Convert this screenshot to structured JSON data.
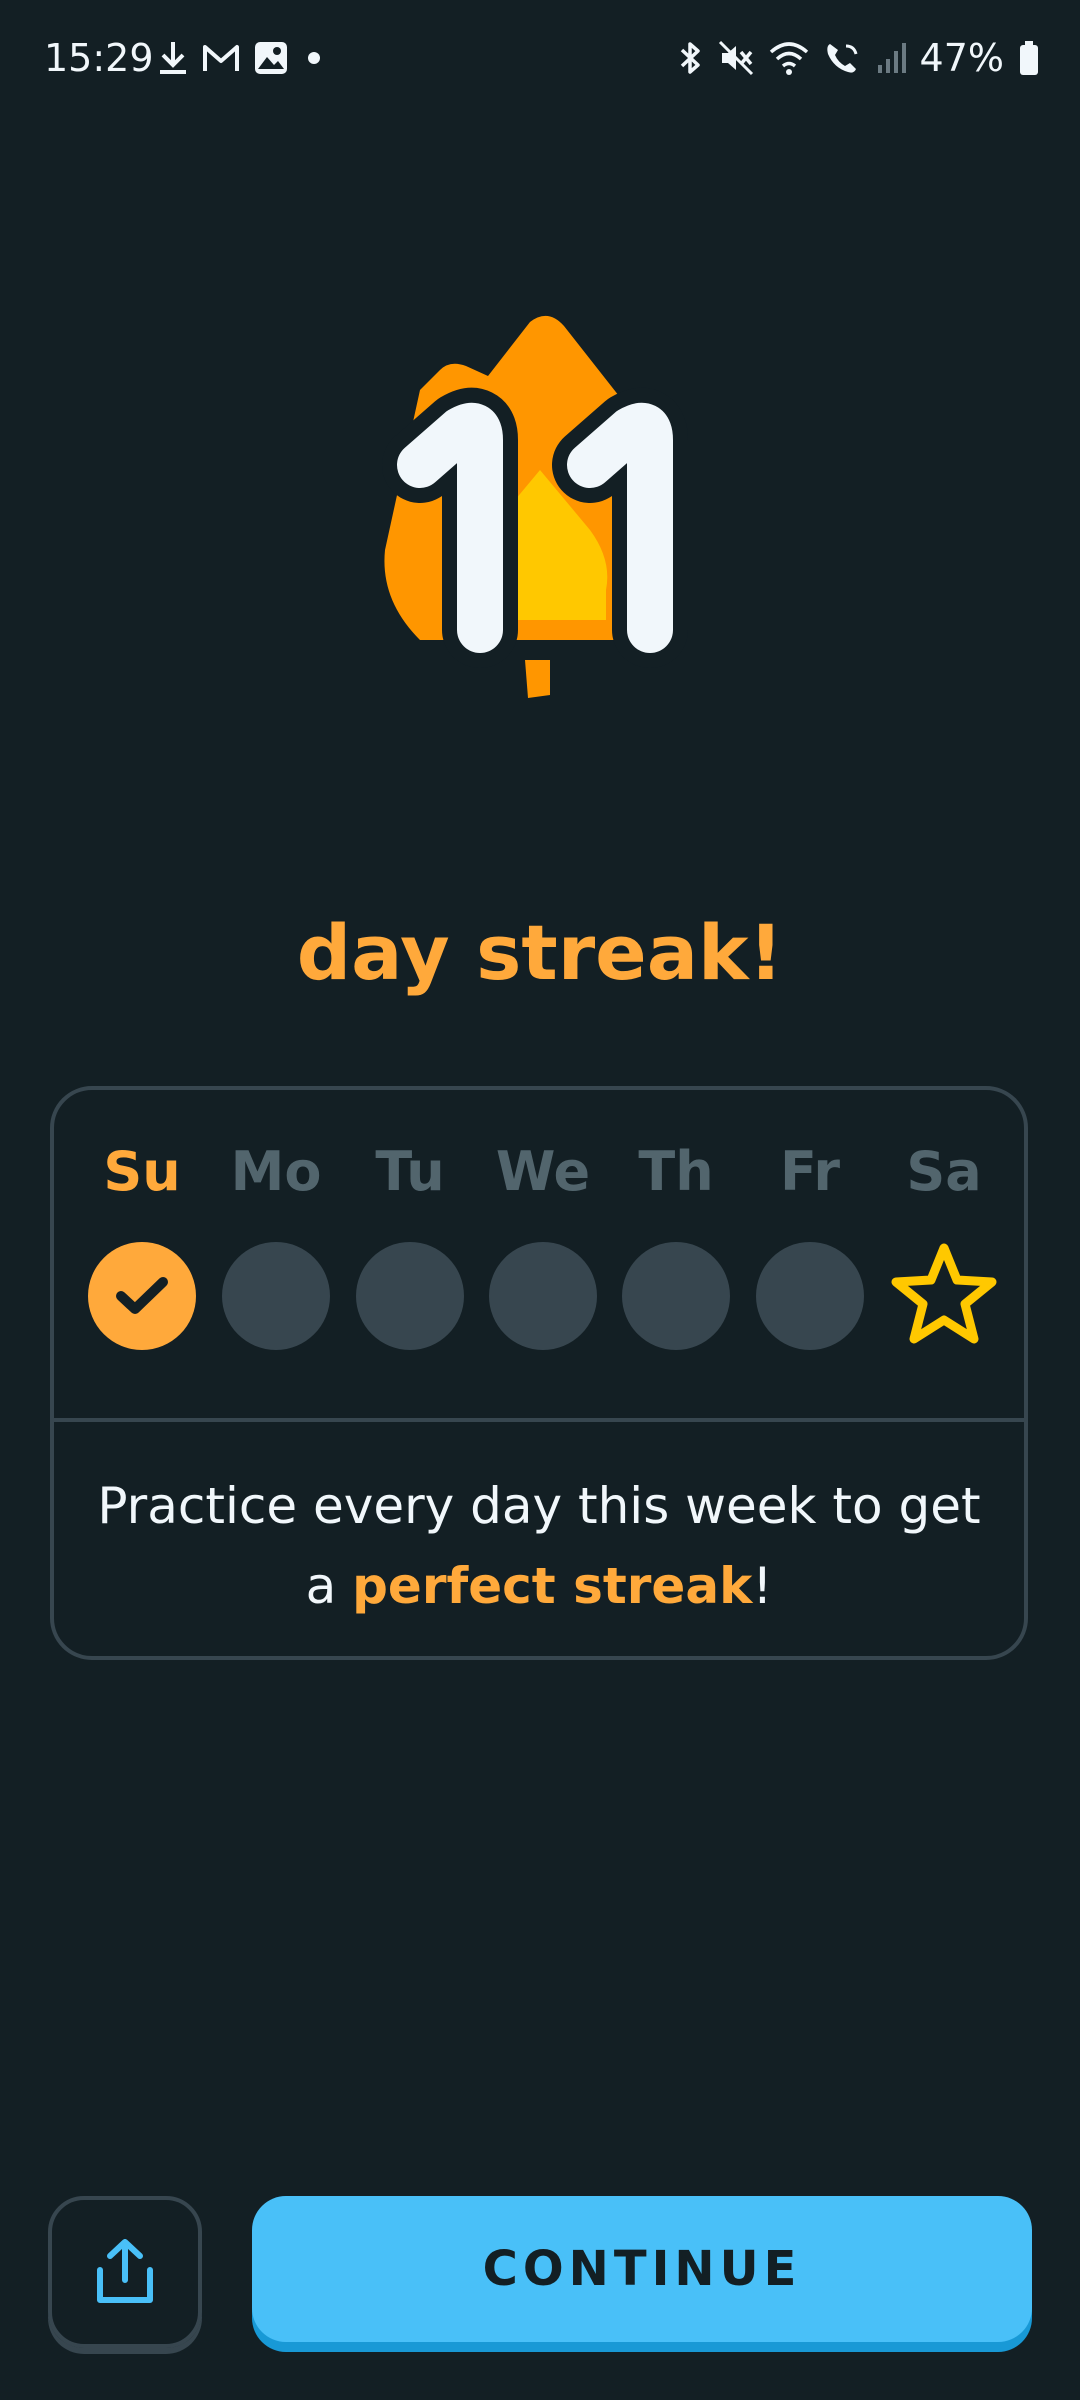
{
  "status_bar": {
    "time": "15:29",
    "battery": "47%",
    "left_icons": [
      "download-icon",
      "gmail-icon",
      "gallery-icon",
      "dot-icon"
    ],
    "right_icons": [
      "bluetooth-icon",
      "mute-icon",
      "wifi-icon",
      "wifi-calling-icon",
      "signal-icon",
      "battery-icon"
    ]
  },
  "streak": {
    "count": "11",
    "label": "day streak!",
    "flame_colors": {
      "outer": "#ff9600",
      "inner": "#ffc800"
    }
  },
  "week": {
    "days": [
      {
        "label": "Su",
        "state": "done"
      },
      {
        "label": "Mo",
        "state": "empty"
      },
      {
        "label": "Tu",
        "state": "empty"
      },
      {
        "label": "We",
        "state": "empty"
      },
      {
        "label": "Th",
        "state": "empty"
      },
      {
        "label": "Fr",
        "state": "empty"
      },
      {
        "label": "Sa",
        "state": "goal"
      }
    ],
    "message_prefix": "Practice every day this week to get a ",
    "message_highlight": "perfect streak",
    "message_suffix": "!"
  },
  "actions": {
    "share_icon": "share-icon",
    "continue_label": "CONTINUE"
  },
  "colors": {
    "background": "#131f24",
    "accent_orange": "#ffa93b",
    "button_blue": "#49c0f8",
    "inactive": "#37464f"
  }
}
